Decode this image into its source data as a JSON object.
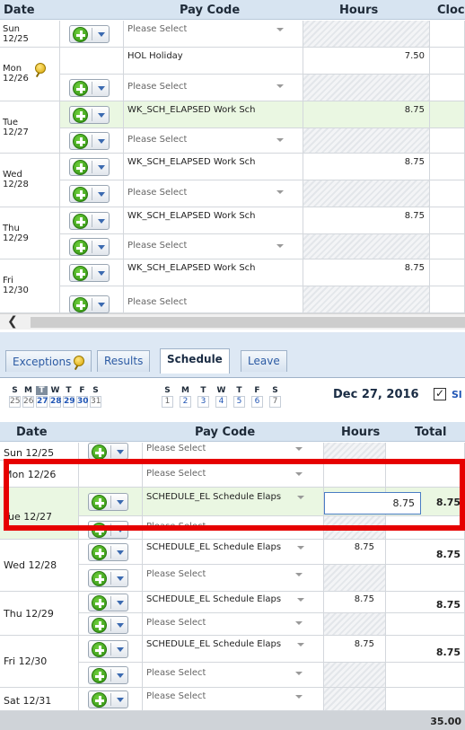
{
  "top_grid": {
    "headers": {
      "date": "Date",
      "pay_code": "Pay Code",
      "hours": "Hours",
      "clock": "Cloc"
    },
    "rows": [
      {
        "day": "Sun",
        "date": "12/25",
        "pay_code": "Please Select",
        "hours": ""
      },
      {
        "day": "Mon",
        "date": "12/26",
        "pay_code": "HOL Holiday",
        "hours": "7.50"
      },
      {
        "pay_code": "Please Select",
        "hours": ""
      },
      {
        "day": "Tue",
        "date": "12/27",
        "pay_code": "WK_SCH_ELAPSED Work Sch",
        "hours": "8.75"
      },
      {
        "pay_code": "Please Select",
        "hours": ""
      },
      {
        "day": "Wed",
        "date": "12/28",
        "pay_code": "WK_SCH_ELAPSED Work Sch",
        "hours": "8.75"
      },
      {
        "pay_code": "Please Select",
        "hours": ""
      },
      {
        "day": "Thu",
        "date": "12/29",
        "pay_code": "WK_SCH_ELAPSED Work Sch",
        "hours": "8.75"
      },
      {
        "pay_code": "Please Select",
        "hours": ""
      },
      {
        "day": "Fri",
        "date": "12/30",
        "pay_code": "WK_SCH_ELAPSED Work Sch",
        "hours": "8.75"
      },
      {
        "pay_code": "Please Select",
        "hours": ""
      }
    ]
  },
  "tabs": [
    {
      "label": "Exceptions"
    },
    {
      "label": "Results"
    },
    {
      "label": "Schedule"
    },
    {
      "label": "Leave"
    }
  ],
  "calendar": {
    "week1": {
      "days": [
        "S",
        "M",
        "T",
        "W",
        "T",
        "F",
        "S"
      ],
      "dates": [
        "25",
        "26",
        "27",
        "28",
        "29",
        "30",
        "31"
      ]
    },
    "week2": {
      "days": [
        "S",
        "M",
        "T",
        "W",
        "T",
        "F",
        "S"
      ],
      "dates": [
        "1",
        "2",
        "3",
        "4",
        "5",
        "6",
        "7"
      ]
    },
    "selected_date": "Dec 27, 2016",
    "show_label": "Sl"
  },
  "bottom_grid": {
    "headers": {
      "date": "Date",
      "pay_code": "Pay Code",
      "hours": "Hours",
      "total": "Total"
    },
    "rows": [
      {
        "date": "Sun 12/25",
        "pay_code": "Please Select",
        "hours": "",
        "total": ""
      },
      {
        "date": "Mon 12/26",
        "pay_code": "Please Select",
        "hours": "",
        "total": ""
      },
      {
        "date": "Tue 12/27",
        "pay_code": "SCHEDULE_EL Schedule Elaps",
        "hours": "8.75",
        "total": "8.75"
      },
      {
        "pay_code": "Please Select",
        "hours": "",
        "total": ""
      },
      {
        "date": "Wed 12/28",
        "pay_code": "SCHEDULE_EL Schedule Elaps",
        "hours": "8.75",
        "total": "8.75"
      },
      {
        "pay_code": "Please Select",
        "hours": "",
        "total": ""
      },
      {
        "date": "Thu 12/29",
        "pay_code": "SCHEDULE_EL Schedule Elaps",
        "hours": "8.75",
        "total": "8.75"
      },
      {
        "pay_code": "Please Select",
        "hours": "",
        "total": ""
      },
      {
        "date": "Fri 12/30",
        "pay_code": "SCHEDULE_EL Schedule Elaps",
        "hours": "8.75",
        "total": "8.75"
      },
      {
        "pay_code": "Please Select",
        "hours": "",
        "total": ""
      },
      {
        "date": "Sat 12/31",
        "pay_code": "Please Select",
        "hours": "",
        "total": ""
      }
    ],
    "footer_total": "35.00"
  },
  "colors": {
    "highlight_box": "#e60000",
    "accent": "#2156b5",
    "header_bg": "#d7e4f1"
  }
}
